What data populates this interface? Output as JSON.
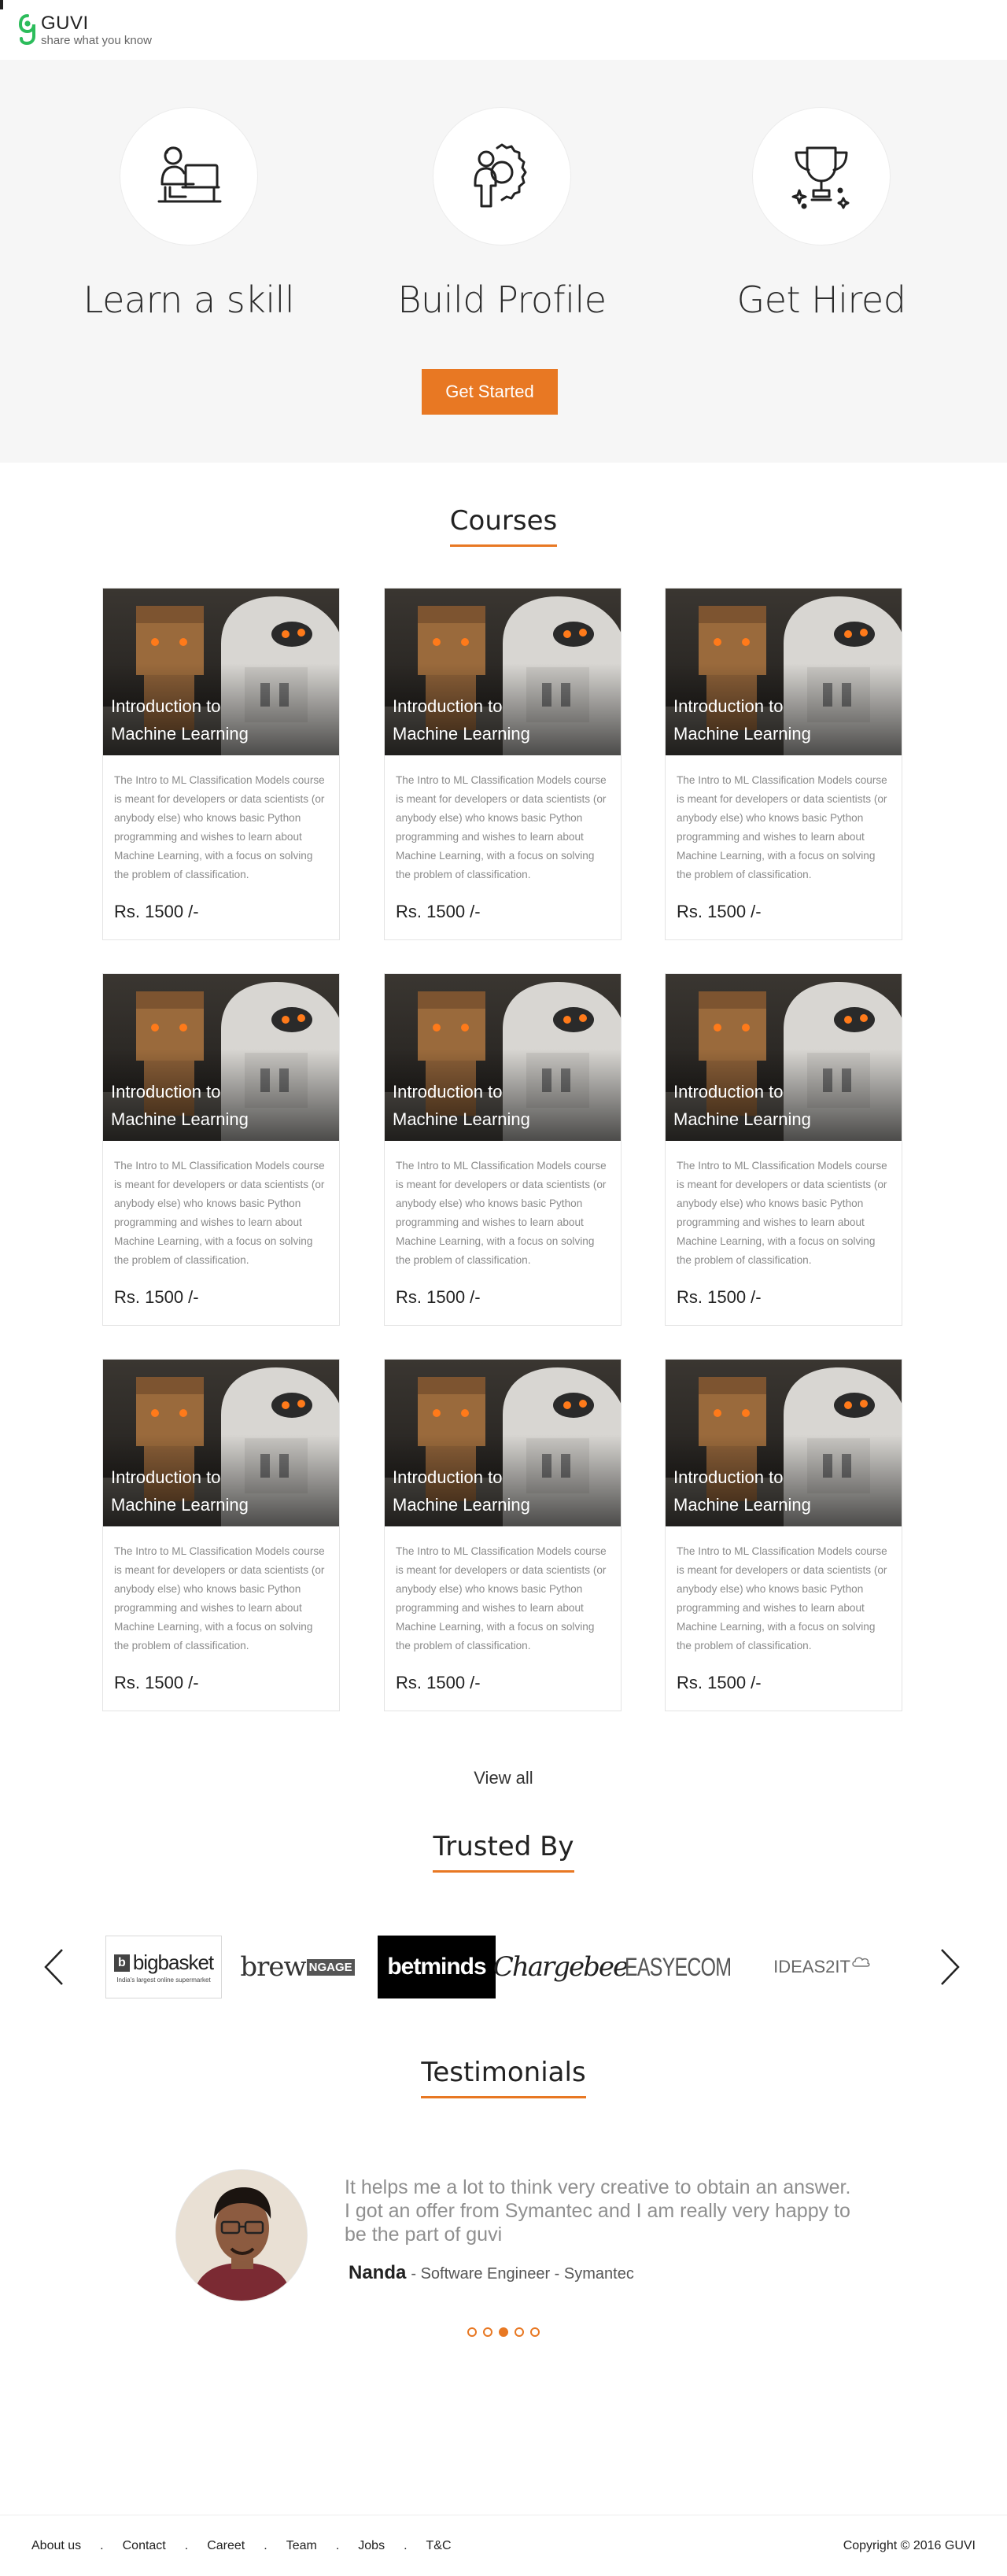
{
  "header": {
    "logo_title": "GUVI",
    "logo_tagline": "share what you know"
  },
  "hero": {
    "items": [
      {
        "label": "Learn a skill",
        "icon": "learner-laptop-icon"
      },
      {
        "label": "Build Profile",
        "icon": "profile-gear-icon"
      },
      {
        "label": "Get Hired",
        "icon": "trophy-icon"
      }
    ],
    "cta_label": "Get Started",
    "accent": "#e87823"
  },
  "courses": {
    "title": "Courses",
    "cards": [
      {
        "title_line1": "Introduction to",
        "title_line2": "Machine Learning",
        "description": "The Intro to ML Classification Models course is meant for developers or data scientists (or anybody else) who knows basic Python programming and wishes to learn about Machine Learning, with a focus on solving the problem of classification.",
        "price": "Rs. 1500 /-"
      },
      {
        "title_line1": "Introduction to",
        "title_line2": "Machine Learning",
        "description": "The Intro to ML Classification Models course is meant for developers or data scientists (or anybody else) who knows basic Python programming and wishes to learn about Machine Learning, with a focus on solving the problem of classification.",
        "price": "Rs. 1500 /-"
      },
      {
        "title_line1": "Introduction to",
        "title_line2": "Machine Learning",
        "description": "The Intro to ML Classification Models course is meant for developers or data scientists (or anybody else) who knows basic Python programming and wishes to learn about Machine Learning, with a focus on solving the problem of classification.",
        "price": "Rs. 1500 /-"
      },
      {
        "title_line1": "Introduction to",
        "title_line2": "Machine Learning",
        "description": "The Intro to ML Classification Models course is meant for developers or data scientists (or anybody else) who knows basic Python programming and wishes to learn about Machine Learning, with a focus on solving the problem of classification.",
        "price": "Rs. 1500 /-"
      },
      {
        "title_line1": "Introduction to",
        "title_line2": "Machine Learning",
        "description": "The Intro to ML Classification Models course is meant for developers or data scientists (or anybody else) who knows basic Python programming and wishes to learn about Machine Learning, with a focus on solving the problem of classification.",
        "price": "Rs. 1500 /-"
      },
      {
        "title_line1": "Introduction to",
        "title_line2": "Machine Learning",
        "description": "The Intro to ML Classification Models course is meant for developers or data scientists (or anybody else) who knows basic Python programming and wishes to learn about Machine Learning, with a focus on solving the problem of classification.",
        "price": "Rs. 1500 /-"
      },
      {
        "title_line1": "Introduction to",
        "title_line2": "Machine Learning",
        "description": "The Intro to ML Classification Models course is meant for developers or data scientists (or anybody else) who knows basic Python programming and wishes to learn about Machine Learning, with a focus on solving the problem of classification.",
        "price": "Rs. 1500 /-"
      },
      {
        "title_line1": "Introduction to",
        "title_line2": "Machine Learning",
        "description": "The Intro to ML Classification Models course is meant for developers or data scientists (or anybody else) who knows basic Python programming and wishes to learn about Machine Learning, with a focus on solving the problem of classification.",
        "price": "Rs. 1500 /-"
      },
      {
        "title_line1": "Introduction to",
        "title_line2": "Machine Learning",
        "description": "The Intro to ML Classification Models course is meant for developers or data scientists (or anybody else) who knows basic Python programming and wishes to learn about Machine Learning, with a focus on solving the problem of classification.",
        "price": "Rs. 1500 /-"
      }
    ],
    "view_all_label": "View all"
  },
  "trusted": {
    "title": "Trusted By",
    "brands": [
      {
        "name": "bigbasket",
        "tagline": "India's largest online supermarket"
      },
      {
        "name": "brew",
        "suffix": "NGAGE"
      },
      {
        "name": "betminds"
      },
      {
        "name": "Chargebee"
      },
      {
        "name": "EASYECOM"
      },
      {
        "name": "IDEAS2IT"
      }
    ]
  },
  "testimonials": {
    "title": "Testimonials",
    "quote": "It helps me a lot to think very creative to obtain an answer. I got an offer from Symantec and I am really very happy to be the part of guvi",
    "author_name": "Nanda",
    "author_role": "- Software Engineer - Symantec",
    "dots_count": 5,
    "active_dot": 2
  },
  "footer": {
    "links": [
      "About us",
      "Contact",
      "Careet",
      "Team",
      "Jobs",
      "T&C"
    ],
    "copyright": "Copyright © 2016 GUVI"
  }
}
